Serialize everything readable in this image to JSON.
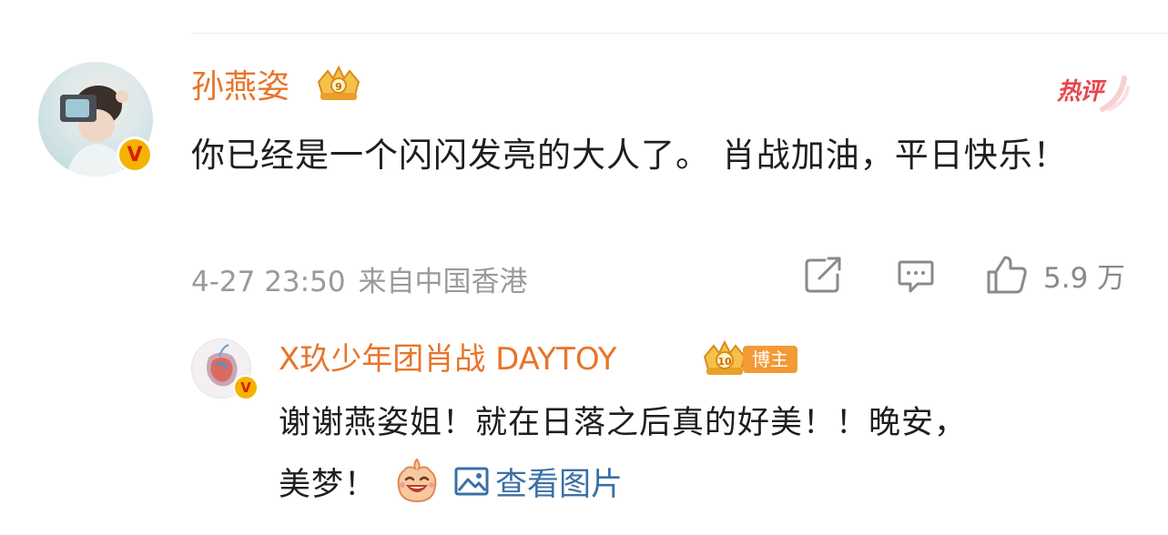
{
  "comment": {
    "username": "孙燕姿",
    "text": "你已经是一个闪闪发亮的大人了。 肖战加油，平日快乐！",
    "hot_label": "热评",
    "date": "4-27 23:50",
    "location": "来自中国香港",
    "like_count": "5.9 万",
    "icons": [
      "share-icon",
      "comment-icon",
      "like-icon",
      "crown-badge-icon",
      "verified-icon"
    ]
  },
  "reply": {
    "username": "X玖少年团肖战 DAYTOY",
    "badge_label": "博主",
    "badge_level": "10",
    "text_line1": "谢谢燕姿姐！就在日落之后真的好美！！晚安，",
    "text_line2": "美梦！",
    "view_image_label": "查看图片",
    "icons": [
      "laugh-emoji-icon",
      "image-icon",
      "verified-icon"
    ]
  },
  "colors": {
    "username": "#e8742a",
    "link": "#3b70a6",
    "meta": "#9a9a9a",
    "hot": "#e8454d",
    "verified": "#f4b300"
  }
}
